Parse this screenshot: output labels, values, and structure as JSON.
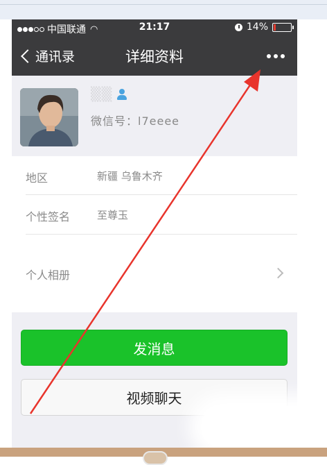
{
  "status_bar": {
    "carrier": "中国联通",
    "time": "21:17",
    "battery": "14%",
    "battery_level": 0.14
  },
  "nav": {
    "back_label": "通讯录",
    "title": "详细资料"
  },
  "profile": {
    "wechat_id": "微信号：l7eeee"
  },
  "info": {
    "region_label": "地区",
    "region_value": "新疆 乌鲁木齐",
    "signature_label": "个性签名",
    "signature_value": "至尊玉",
    "album_label": "个人相册"
  },
  "actions": {
    "send_message": "发消息",
    "video_chat": "视频聊天"
  },
  "colors": {
    "nav_bg": "#3b3b3d",
    "primary_green": "#1ac22a",
    "annotation_red": "#e8342c"
  }
}
